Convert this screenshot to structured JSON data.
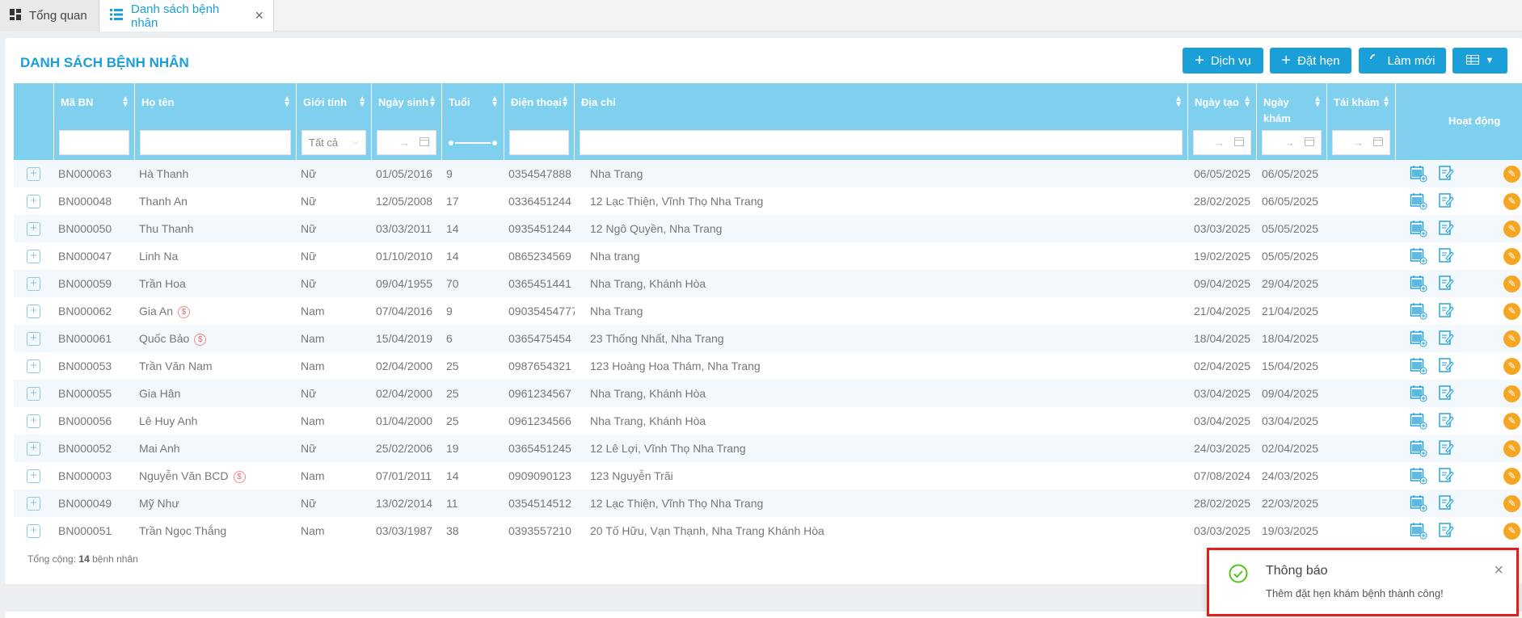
{
  "tabs": [
    {
      "label": "Tổng quan",
      "icon": "dashboard-icon"
    },
    {
      "label": "Danh sách bệnh nhân",
      "icon": "list-icon"
    }
  ],
  "page_title": "DANH SÁCH BỆNH NHÂN",
  "toolbar": {
    "service_label": "Dịch vụ",
    "appointment_label": "Đặt hẹn",
    "refresh_label": "Làm mới"
  },
  "columns": {
    "code": "Mã BN",
    "name": "Họ tên",
    "gender": "Giới tính",
    "dob": "Ngày sinh",
    "age": "Tuổi",
    "phone": "Điện thoại",
    "address": "Địa chỉ",
    "created": "Ngày tạo",
    "visit": "Ngày khám",
    "revisit": "Tái khám",
    "actions": "Hoạt động"
  },
  "filters": {
    "gender_value": "Tất cả",
    "date_arrow": "→"
  },
  "rows": [
    {
      "code": "BN000063",
      "name": "Hà Thanh",
      "gender": "Nữ",
      "dob": "01/05/2016",
      "age": "9",
      "phone": "0354547888",
      "address": "Nha Trang",
      "created": "06/05/2025",
      "visit": "06/05/2025",
      "badge": false
    },
    {
      "code": "BN000048",
      "name": "Thanh An",
      "gender": "Nữ",
      "dob": "12/05/2008",
      "age": "17",
      "phone": "0336451244",
      "address": "12 Lạc Thiện, Vĩnh Thọ Nha Trang",
      "created": "28/02/2025",
      "visit": "06/05/2025",
      "badge": false
    },
    {
      "code": "BN000050",
      "name": "Thu Thanh",
      "gender": "Nữ",
      "dob": "03/03/2011",
      "age": "14",
      "phone": "0935451244",
      "address": "12 Ngô Quyền, Nha Trang",
      "created": "03/03/2025",
      "visit": "05/05/2025",
      "badge": false
    },
    {
      "code": "BN000047",
      "name": "Linh Na",
      "gender": "Nữ",
      "dob": "01/10/2010",
      "age": "14",
      "phone": "0865234569",
      "address": "Nha trang",
      "created": "19/02/2025",
      "visit": "05/05/2025",
      "badge": false
    },
    {
      "code": "BN000059",
      "name": "Trần Hoa",
      "gender": "Nữ",
      "dob": "09/04/1955",
      "age": "70",
      "phone": "0365451441",
      "address": "Nha Trang, Khánh Hòa",
      "created": "09/04/2025",
      "visit": "29/04/2025",
      "badge": false
    },
    {
      "code": "BN000062",
      "name": "Gia An",
      "gender": "Nam",
      "dob": "07/04/2016",
      "age": "9",
      "phone": "09035454777",
      "address": "Nha Trang",
      "created": "21/04/2025",
      "visit": "21/04/2025",
      "badge": true
    },
    {
      "code": "BN000061",
      "name": "Quốc Bảo",
      "gender": "Nam",
      "dob": "15/04/2019",
      "age": "6",
      "phone": "0365475454",
      "address": "23 Thống Nhất, Nha Trang",
      "created": "18/04/2025",
      "visit": "18/04/2025",
      "badge": true
    },
    {
      "code": "BN000053",
      "name": "Trần Văn Nam",
      "gender": "Nam",
      "dob": "02/04/2000",
      "age": "25",
      "phone": "0987654321",
      "address": "123 Hoàng Hoa Thám, Nha Trang",
      "created": "02/04/2025",
      "visit": "15/04/2025",
      "badge": false
    },
    {
      "code": "BN000055",
      "name": "Gia Hân",
      "gender": "Nữ",
      "dob": "02/04/2000",
      "age": "25",
      "phone": "0961234567",
      "address": "Nha Trang, Khánh Hòa",
      "created": "03/04/2025",
      "visit": "09/04/2025",
      "badge": false
    },
    {
      "code": "BN000056",
      "name": "Lê Huy Anh",
      "gender": "Nam",
      "dob": "01/04/2000",
      "age": "25",
      "phone": "0961234566",
      "address": "Nha Trang, Khánh Hòa",
      "created": "03/04/2025",
      "visit": "03/04/2025",
      "badge": false
    },
    {
      "code": "BN000052",
      "name": "Mai Anh",
      "gender": "Nữ",
      "dob": "25/02/2006",
      "age": "19",
      "phone": "0365451245",
      "address": "12 Lê Lợi, Vĩnh Thọ Nha Trang",
      "created": "24/03/2025",
      "visit": "02/04/2025",
      "badge": false
    },
    {
      "code": "BN000003",
      "name": "Nguyễn Văn BCD",
      "gender": "Nam",
      "dob": "07/01/2011",
      "age": "14",
      "phone": "0909090123",
      "address": "123 Nguyễn Trãi",
      "created": "07/08/2024",
      "visit": "24/03/2025",
      "badge": true
    },
    {
      "code": "BN000049",
      "name": "Mỹ Như",
      "gender": "Nữ",
      "dob": "13/02/2014",
      "age": "11",
      "phone": "0354514512",
      "address": "12 Lạc Thiện, Vĩnh Thọ Nha Trang",
      "created": "28/02/2025",
      "visit": "22/03/2025",
      "badge": false
    },
    {
      "code": "BN000051",
      "name": "Trần Ngọc Thắng",
      "gender": "Nam",
      "dob": "03/03/1987",
      "age": "38",
      "phone": "0393557210",
      "address": "20 Tố Hữu, Vạn Thạnh, Nha Trang Khánh Hòa",
      "created": "03/03/2025",
      "visit": "19/03/2025",
      "badge": false
    }
  ],
  "footer": {
    "total_prefix": "Tổng cộng:",
    "total_count": "14",
    "total_suffix": "bệnh nhân"
  },
  "toast": {
    "title": "Thông báo",
    "message": "Thêm đặt hẹn khám bệnh thành công!",
    "status_color": "#52c41a",
    "border_color": "#e01e1e"
  },
  "colors": {
    "accent": "#1a9fd9",
    "header_bg": "#7fd0ef",
    "action_orange": "#f5a623"
  }
}
